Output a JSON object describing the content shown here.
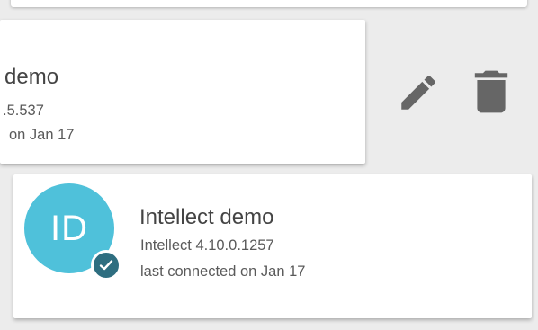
{
  "colors": {
    "background": "#ececec",
    "card": "#ffffff",
    "avatar": "#4fc1da",
    "badge": "#2e6e80",
    "icon": "#666666",
    "title_text": "#444444",
    "secondary_text": "#5a5a5a"
  },
  "swiped_server": {
    "title": "demo",
    "version": ".5.537",
    "last_connected": "on Jan 17"
  },
  "actions": {
    "edit_icon": "pencil-icon",
    "delete_icon": "trash-icon"
  },
  "server": {
    "avatar_initials": "ID",
    "status_icon": "check-icon",
    "title": "Intellect demo",
    "version": "Intellect 4.10.0.1257",
    "last_connected": "last connected on Jan 17"
  }
}
